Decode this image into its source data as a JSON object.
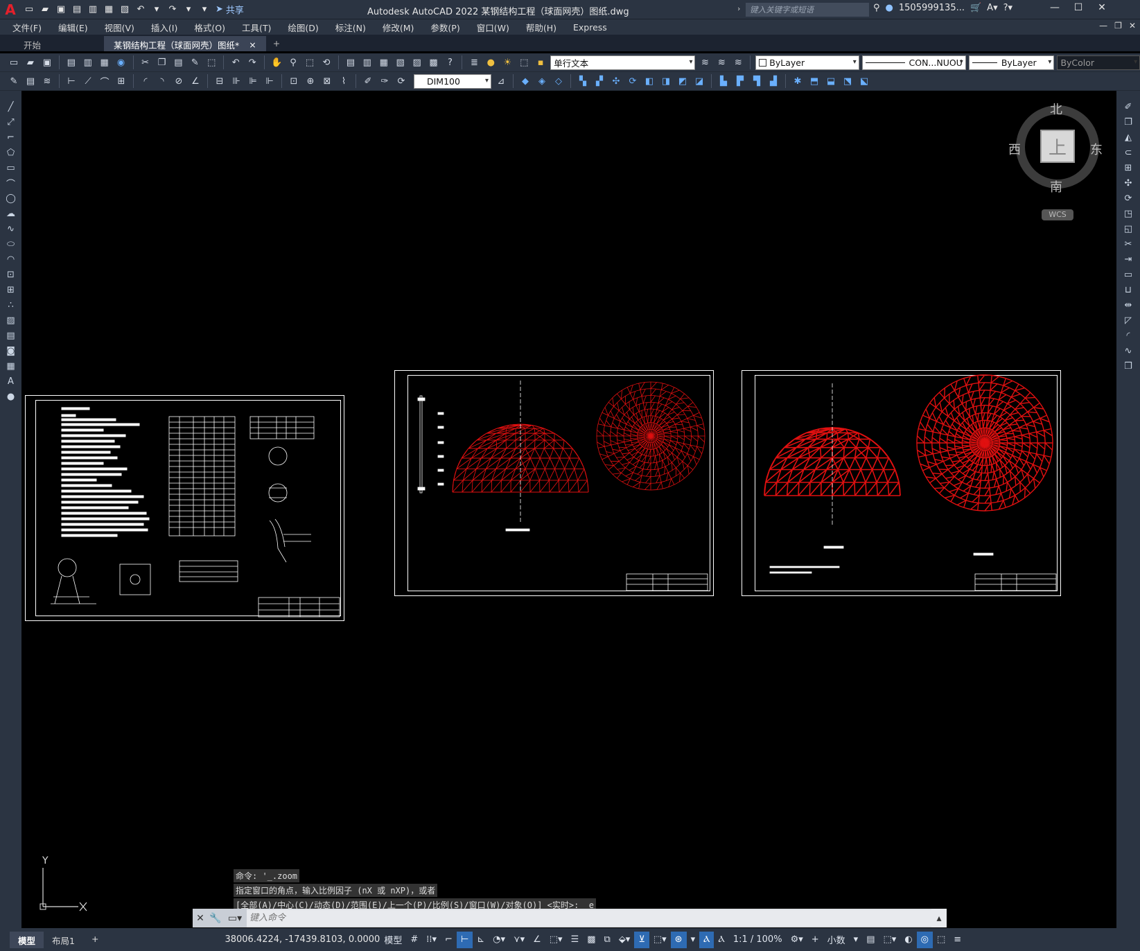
{
  "titlebar": {
    "logo": "A",
    "share_label": "共享",
    "title": "Autodesk AutoCAD 2022    某钢结构工程（球面网壳）图纸.dwg",
    "search_placeholder": "键入关键字或短语",
    "user": "1505999135..."
  },
  "menu": [
    "文件(F)",
    "编辑(E)",
    "视图(V)",
    "插入(I)",
    "格式(O)",
    "工具(T)",
    "绘图(D)",
    "标注(N)",
    "修改(M)",
    "参数(P)",
    "窗口(W)",
    "帮助(H)",
    "Express"
  ],
  "file_tabs": {
    "start": "开始",
    "active": "某钢结构工程（球面网壳）图纸*",
    "close": "×",
    "add": "+"
  },
  "toolbar1": {
    "text_style": "单行文本",
    "color": "ByLayer",
    "linetype": "CON...NUOU",
    "lineweight": "ByLayer",
    "plotstyle": "ByColor"
  },
  "toolbar2": {
    "dim_style": "DIM100"
  },
  "viewcube": {
    "north": "北",
    "south": "南",
    "west": "西",
    "east": "东",
    "face": "上",
    "wcs": "WCS"
  },
  "ucs": {
    "y": "Y"
  },
  "command": {
    "history": [
      "命令: '_.zoom",
      "指定窗口的角点，输入比例因子 (nX 或 nXP)，或者",
      "[全部(A)/中心(C)/动态(D)/范围(E)/上一个(P)/比例(S)/窗口(W)/对象(O)] <实时>: _e"
    ],
    "placeholder": "键入命令"
  },
  "status": {
    "tabs": [
      "模型",
      "布局1"
    ],
    "add_tab": "+",
    "coords": "38006.4224, -17439.8103, 0.0000",
    "space": "模型",
    "scale": "1:1 / 100%",
    "units": "小数"
  },
  "colors": {
    "canvas": "#000000",
    "chrome": "#2b3442",
    "drawing_red": "#e01010",
    "accent": "#2e6bb3"
  }
}
